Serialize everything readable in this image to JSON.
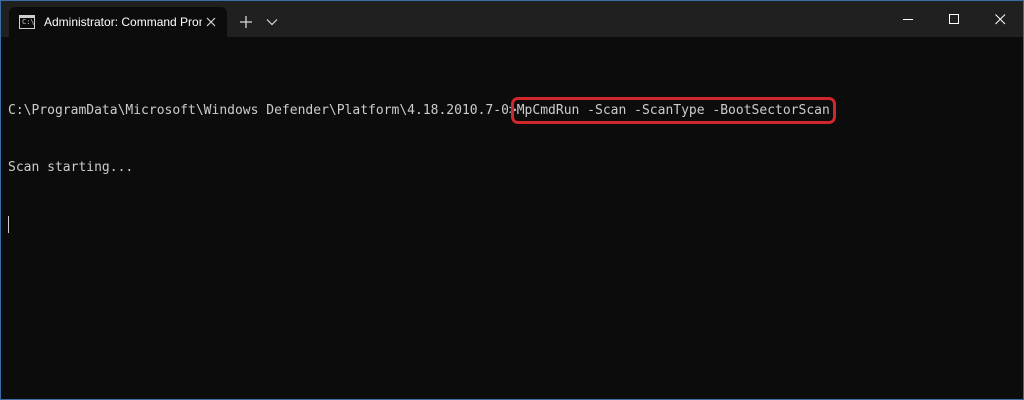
{
  "window": {
    "tab_title": "Administrator: Command Prompt",
    "icon": "command-prompt-icon",
    "new_tab_icon": "plus-icon",
    "dropdown_icon": "chevron-down-icon",
    "caption_icons": [
      "minimize-icon",
      "maximize-icon",
      "close-icon"
    ]
  },
  "console": {
    "prompt": "C:\\ProgramData\\Microsoft\\Windows Defender\\Platform\\4.18.2010.7-0>",
    "command": "MpCmdRun -Scan -ScanType -BootSectorScan",
    "output": "Scan starting..."
  },
  "colors": {
    "background": "#0c0c0c",
    "titlebar": "#202020",
    "text": "#cccccc",
    "highlight": "#d0262c"
  }
}
